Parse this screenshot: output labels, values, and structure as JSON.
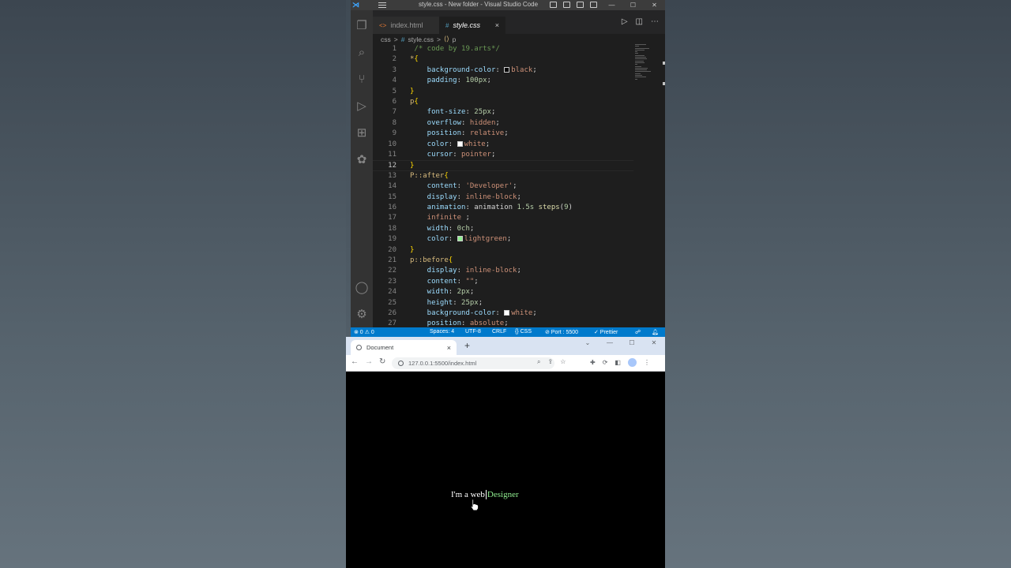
{
  "vscode": {
    "window_title": "style.css - New folder - Visual Studio Code",
    "tabs": [
      {
        "icon": "<>",
        "label": "index.html"
      },
      {
        "icon": "#",
        "label": "style.css",
        "close": "×"
      }
    ],
    "breadcrumb": {
      "folder": "css",
      "sep": ">",
      "file": "style.css",
      "symbol": "p"
    },
    "active_line": 12,
    "status": {
      "problems": "⊗ 0 ⚠ 0",
      "spaces": "Spaces: 4",
      "encoding": "UTF-8",
      "eol": "CRLF",
      "language": "{} CSS",
      "port": "⊘ Port : 5500",
      "formatter": "✓ Prettier"
    }
  },
  "code_lines": [
    [
      [
        "t-comment",
        " /* code by 19.arts*/"
      ]
    ],
    [
      [
        "t-sel",
        "*"
      ],
      [
        "t-brace",
        "{"
      ]
    ],
    [
      [
        "t-prop",
        "    background-color"
      ],
      [
        "t-punc",
        ": "
      ],
      [
        "swatch",
        "#000000"
      ],
      [
        "t-val",
        "black"
      ],
      [
        "t-punc",
        ";"
      ]
    ],
    [
      [
        "t-prop",
        "    padding"
      ],
      [
        "t-punc",
        ": "
      ],
      [
        "t-num",
        "100px"
      ],
      [
        "t-punc",
        ";"
      ]
    ],
    [
      [
        "t-brace",
        "}"
      ]
    ],
    [
      [
        "t-sel",
        "p"
      ],
      [
        "t-brace",
        "{"
      ]
    ],
    [
      [
        "t-prop",
        "    font-size"
      ],
      [
        "t-punc",
        ": "
      ],
      [
        "t-num",
        "25px"
      ],
      [
        "t-punc",
        ";"
      ]
    ],
    [
      [
        "t-prop",
        "    overflow"
      ],
      [
        "t-punc",
        ": "
      ],
      [
        "t-val",
        "hidden"
      ],
      [
        "t-punc",
        ";"
      ]
    ],
    [
      [
        "t-prop",
        "    position"
      ],
      [
        "t-punc",
        ": "
      ],
      [
        "t-val",
        "relative"
      ],
      [
        "t-punc",
        ";"
      ]
    ],
    [
      [
        "t-prop",
        "    color"
      ],
      [
        "t-punc",
        ": "
      ],
      [
        "swatch",
        "#ffffff"
      ],
      [
        "t-val",
        "white"
      ],
      [
        "t-punc",
        ";"
      ]
    ],
    [
      [
        "t-prop",
        "    cursor"
      ],
      [
        "t-punc",
        ": "
      ],
      [
        "t-val",
        "pointer"
      ],
      [
        "t-punc",
        ";"
      ]
    ],
    [
      [
        "t-brace",
        "}"
      ]
    ],
    [
      [
        "t-sel",
        "P::after"
      ],
      [
        "t-brace",
        "{"
      ]
    ],
    [
      [
        "t-prop",
        "    content"
      ],
      [
        "t-punc",
        ": "
      ],
      [
        "t-val",
        "'Developer'"
      ],
      [
        "t-punc",
        ";"
      ]
    ],
    [
      [
        "t-prop",
        "    display"
      ],
      [
        "t-punc",
        ": "
      ],
      [
        "t-val",
        "inline-block"
      ],
      [
        "t-punc",
        ";"
      ]
    ],
    [
      [
        "t-prop",
        "    animation"
      ],
      [
        "t-punc",
        ": "
      ],
      [
        "t-fn",
        "animation "
      ],
      [
        "t-num",
        "1.5s "
      ],
      [
        "t-kw",
        "steps"
      ],
      [
        "t-punc",
        "("
      ],
      [
        "t-num",
        "9"
      ],
      [
        "t-punc",
        ")"
      ]
    ],
    [
      [
        "t-val",
        "    infinite "
      ],
      [
        "t-punc",
        ";"
      ]
    ],
    [
      [
        "t-prop",
        "    width"
      ],
      [
        "t-punc",
        ": "
      ],
      [
        "t-num",
        "0ch"
      ],
      [
        "t-punc",
        ";"
      ]
    ],
    [
      [
        "t-prop",
        "    color"
      ],
      [
        "t-punc",
        ": "
      ],
      [
        "swatch",
        "#90ee90"
      ],
      [
        "t-val",
        "lightgreen"
      ],
      [
        "t-punc",
        ";"
      ]
    ],
    [
      [
        "t-brace",
        "}"
      ]
    ],
    [
      [
        "t-sel",
        "p::before"
      ],
      [
        "t-brace",
        "{"
      ]
    ],
    [
      [
        "t-prop",
        "    display"
      ],
      [
        "t-punc",
        ": "
      ],
      [
        "t-val",
        "inline-block"
      ],
      [
        "t-punc",
        ";"
      ]
    ],
    [
      [
        "t-prop",
        "    content"
      ],
      [
        "t-punc",
        ": "
      ],
      [
        "t-val",
        "\"\""
      ],
      [
        "t-punc",
        ";"
      ]
    ],
    [
      [
        "t-prop",
        "    width"
      ],
      [
        "t-punc",
        ": "
      ],
      [
        "t-num",
        "2px"
      ],
      [
        "t-punc",
        ";"
      ]
    ],
    [
      [
        "t-prop",
        "    height"
      ],
      [
        "t-punc",
        ": "
      ],
      [
        "t-num",
        "25px"
      ],
      [
        "t-punc",
        ";"
      ]
    ],
    [
      [
        "t-prop",
        "    background-color"
      ],
      [
        "t-punc",
        ": "
      ],
      [
        "swatch",
        "#ffffff"
      ],
      [
        "t-val",
        "white"
      ],
      [
        "t-punc",
        ";"
      ]
    ],
    [
      [
        "t-prop",
        "    position"
      ],
      [
        "t-punc",
        ": "
      ],
      [
        "t-val",
        "absolute"
      ],
      [
        "t-punc",
        ";"
      ]
    ]
  ],
  "chrome": {
    "tab_title": "Document",
    "tab_close": "×",
    "new_tab": "+",
    "url": "127.0.0.1:5500/index.html"
  },
  "page": {
    "text": "I'm a web",
    "animated_word": "Designer",
    "animated_color": "#90ee90"
  }
}
